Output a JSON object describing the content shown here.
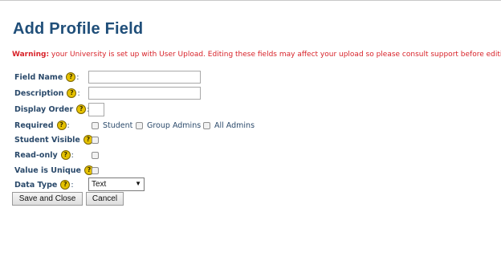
{
  "page": {
    "title": "Add Profile Field"
  },
  "warning": {
    "prefix": "Warning:",
    "text": " your University is set up with User Upload. Editing these fields may affect your upload so please consult support before editing."
  },
  "fields": {
    "field_name": {
      "label": "Field Name",
      "value": ""
    },
    "description": {
      "label": "Description",
      "value": ""
    },
    "display_order": {
      "label": "Display Order",
      "value": ""
    },
    "required": {
      "label": "Required",
      "options": [
        "Student",
        "Group Admins",
        "All Admins"
      ]
    },
    "student_visible": {
      "label": "Student Visible"
    },
    "read_only": {
      "label": "Read-only"
    },
    "value_unique": {
      "label": "Value is Unique"
    },
    "data_type": {
      "label": "Data Type",
      "selected": "Text"
    }
  },
  "help_glyph": "?",
  "colon": ":",
  "actions": {
    "save_label": "Save and Close",
    "cancel_label": "Cancel"
  },
  "colors": {
    "title": "#1f4e79",
    "warning": "#d8232a",
    "help_icon": "#e6c200"
  }
}
